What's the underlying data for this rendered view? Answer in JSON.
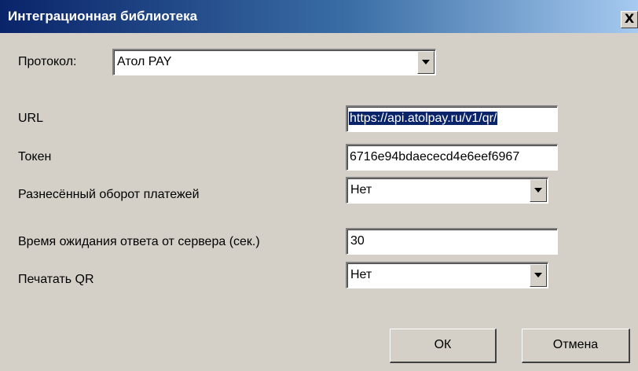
{
  "window": {
    "title": "Интеграционная библиотека",
    "close_label": "X"
  },
  "protocol": {
    "label": "Протокол:",
    "value": "Атол PAY"
  },
  "url": {
    "label": "URL",
    "value": "https://api.atolpay.ru/v1/qr/"
  },
  "token": {
    "label": "Токен",
    "value": "6716e94bdaececd4e6eef6967"
  },
  "split_payments": {
    "label": "Разнесённый оборот платежей",
    "value": "Нет"
  },
  "timeout": {
    "label": "Время ожидания ответа от сервера (сек.)",
    "value": "30"
  },
  "print_qr": {
    "label": "Печатать QR",
    "value": "Нет"
  },
  "buttons": {
    "ok": "ОК",
    "cancel": "Отмена"
  }
}
